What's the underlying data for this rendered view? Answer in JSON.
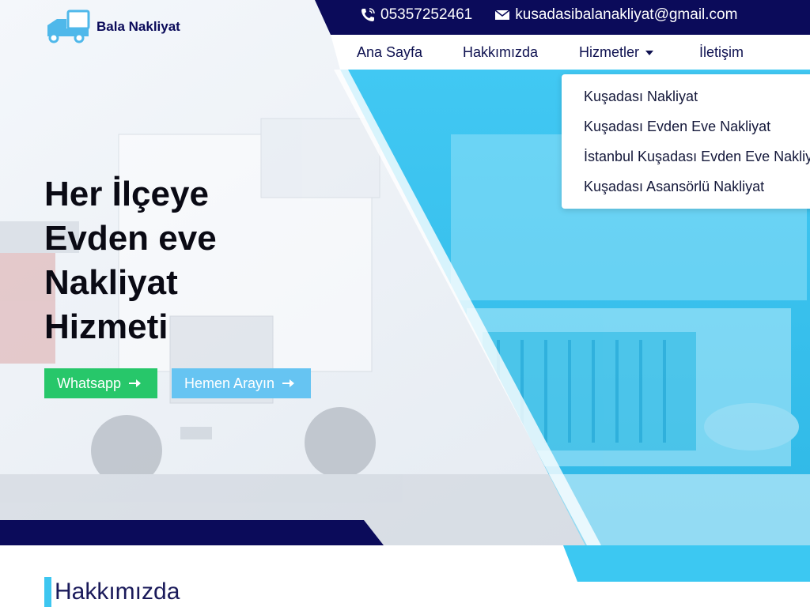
{
  "brand": {
    "name": "Bala Nakliyat"
  },
  "contact": {
    "phone": "05357252461",
    "email": "kusadasibalanakliyat@gmail.com"
  },
  "nav": {
    "items": [
      "Ana Sayfa",
      "Hakkımızda",
      "Hizmetler",
      "İletişim"
    ],
    "dropdown": [
      "Kuşadası Nakliyat",
      "Kuşadası Evden Eve Nakliyat",
      "İstanbul Kuşadası Evden Eve Nakliyat",
      "Kuşadası Asansörlü Nakliyat"
    ]
  },
  "hero": {
    "lines": [
      "Her İlçeye",
      "Evden eve",
      "Nakliyat",
      "Hizmeti"
    ],
    "buttons": {
      "whatsapp": "Whatsapp",
      "call": "Hemen Arayın"
    }
  },
  "section": {
    "title": "Hakkımızda"
  },
  "colors": {
    "navy": "#0b0b5a",
    "cyan": "#3cc8f2",
    "green": "#27c76a",
    "light_blue": "#66c4f2"
  }
}
